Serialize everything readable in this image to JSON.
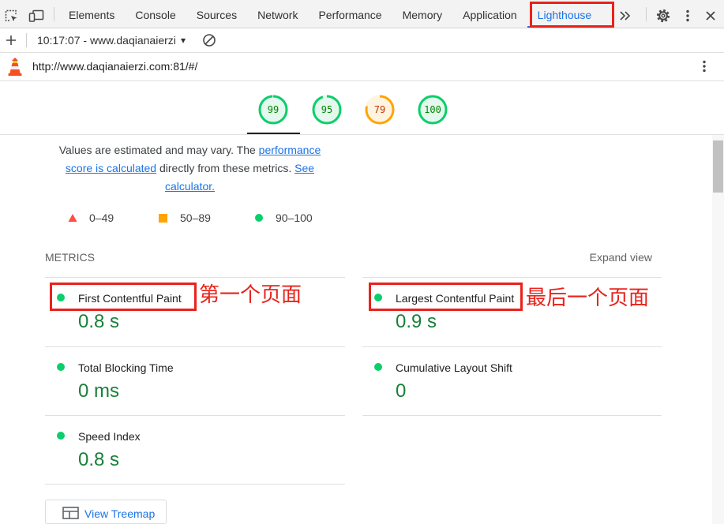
{
  "devtools": {
    "tabs": [
      {
        "label": "Elements"
      },
      {
        "label": "Console"
      },
      {
        "label": "Sources"
      },
      {
        "label": "Network"
      },
      {
        "label": "Performance"
      },
      {
        "label": "Memory"
      },
      {
        "label": "Application"
      },
      {
        "label": "Lighthouse",
        "active": true
      }
    ],
    "icons": {
      "inspect": "inspect-element-icon",
      "device": "device-toolbar-icon",
      "more_tabs": "chevron-double-right-icon",
      "settings": "gear-icon",
      "menu": "kebab-menu-icon",
      "close": "close-icon"
    }
  },
  "report_selector": {
    "label": "10:17:07 - www.daqianaierzi",
    "dropdown_glyph": "▾",
    "icons": {
      "new_report": "plus-icon",
      "clear": "clear-icon"
    }
  },
  "report_header": {
    "url": "http://www.daqianaierzi.com:81/#/",
    "icons": {
      "logo": "lighthouse-logo-icon",
      "menu": "kebab-menu-icon"
    }
  },
  "scores": [
    {
      "value": 99,
      "ring": "#0cce6b",
      "fill": "#e4f8ee",
      "text": "#008800"
    },
    {
      "value": 95,
      "ring": "#0cce6b",
      "fill": "#e4f8ee",
      "text": "#008800"
    },
    {
      "value": 79,
      "ring": "#ffa400",
      "fill": "#fff4e0",
      "text": "#c33300"
    },
    {
      "value": 100,
      "ring": "#0cce6b",
      "fill": "#e4f8ee",
      "text": "#008800"
    }
  ],
  "intro": {
    "text_before": "Values are estimated and may vary. The ",
    "link_score": "performance score is calculated",
    "text_middle": " directly from these metrics. ",
    "link_calculator": "See calculator."
  },
  "legend": [
    {
      "range": "0–49",
      "color": "#ff4e42",
      "shape_icon": "triangle-icon"
    },
    {
      "range": "50–89",
      "color": "#ffa400",
      "shape_icon": "square-icon"
    },
    {
      "range": "90–100",
      "color": "#0cce6b",
      "shape_icon": "circle-icon"
    }
  ],
  "metrics": {
    "heading": "METRICS",
    "expand_label": "Expand view",
    "items": [
      {
        "label": "First Contentful Paint",
        "value": "0.8 s",
        "color": "#0cce6b"
      },
      {
        "label": "Largest Contentful Paint",
        "value": "0.9 s",
        "color": "#0cce6b"
      },
      {
        "label": "Total Blocking Time",
        "value": "0 ms",
        "color": "#0cce6b"
      },
      {
        "label": "Cumulative Layout Shift",
        "value": "0",
        "color": "#0cce6b"
      },
      {
        "label": "Speed Index",
        "value": "0.8 s",
        "color": "#0cce6b"
      }
    ]
  },
  "annotations": {
    "fcp_note": "第一个页面",
    "lcp_note": "最后一个页面"
  },
  "treemap_button": {
    "label": "View Treemap",
    "icon": "treemap-icon"
  },
  "colors": {
    "link": "#1a73e8",
    "annotation": "#e8221b",
    "metric_value": "#188038"
  }
}
